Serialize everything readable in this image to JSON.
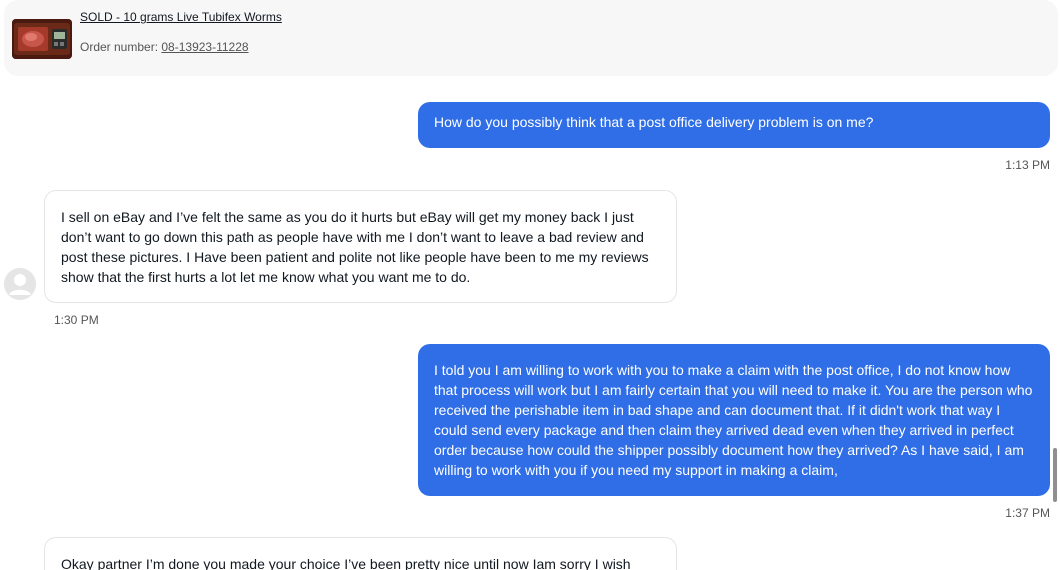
{
  "item": {
    "title": "SOLD - 10 grams Live Tubifex Worms",
    "order_label": "Order number: ",
    "order_number": "08-13923-11228"
  },
  "messages": [
    {
      "text": "How do you possibly think that a post office delivery problem is on me?",
      "time": "1:13 PM",
      "direction": "outgoing"
    },
    {
      "text": "I sell on eBay and I’ve felt the same as you do it hurts but eBay will get my money back I just don’t want to go down this path as people have with me I don’t want to leave a bad review and post these pictures. I Have been patient and polite not like people have been to me my reviews show that the first hurts a lot let me know what you want me to do.",
      "time": "1:30 PM",
      "direction": "incoming"
    },
    {
      "text": "I told you I am willing to work with you to make a claim with the post office, I do not know how that process will work but I am fairly certain that you will need to make it. You are the person who received the perishable item in bad shape and can document that. If it didn't work that way I could send every package and then claim they arrived dead even when they arrived in perfect order because how could the shipper possibly document how they arrived? As I have said, I am willing to work with you if you need my support in making a claim,",
      "time": "1:37 PM",
      "direction": "outgoing"
    },
    {
      "text": "Okay partner I’m done you made your choice I’ve been pretty nice until now Iam sorry I wish",
      "time": "",
      "direction": "incoming"
    }
  ],
  "colors": {
    "outgoing_bubble": "#2f6ee6",
    "incoming_bubble": "#ffffff",
    "header_card": "#f7f7f7"
  },
  "icons": {
    "avatar": "default-user-avatar-icon",
    "thumbnail": "product-thumbnail"
  }
}
